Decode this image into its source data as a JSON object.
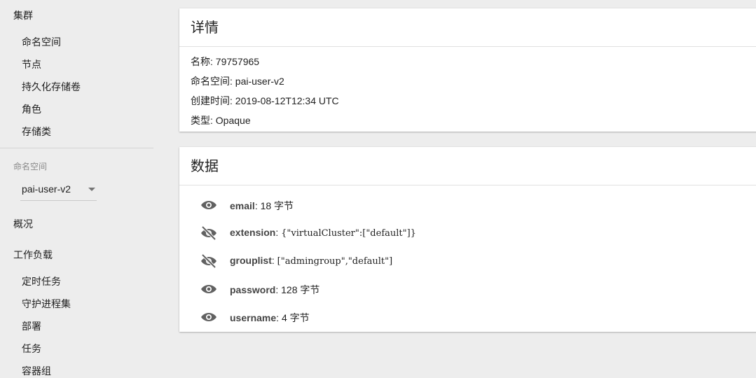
{
  "sidebar": {
    "cluster_label": "集群",
    "cluster_items": [
      "命名空间",
      "节点",
      "持久化存储卷",
      "角色",
      "存储类"
    ],
    "namespace_label": "命名空间",
    "namespace_value": "pai-user-v2",
    "overview_label": "概况",
    "workloads_label": "工作负载",
    "workload_items": [
      "定时任务",
      "守护进程集",
      "部署",
      "任务",
      "容器组"
    ]
  },
  "details": {
    "title": "详情",
    "name_label": "名称",
    "name_value": "79757965",
    "namespace_label": "命名空间",
    "namespace_value": "pai-user-v2",
    "created_label": "创建时间",
    "created_value": "2019-08-12T12:34 UTC",
    "type_label": "类型",
    "type_value": "Opaque"
  },
  "data_section": {
    "title": "数据",
    "rows": [
      {
        "key": "email",
        "value": "18 字节",
        "icon": "visibility-icon",
        "revealed": false
      },
      {
        "key": "extension",
        "value": "{\"virtualCluster\":[\"default\"]}",
        "icon": "visibility-off-icon",
        "revealed": true
      },
      {
        "key": "grouplist",
        "value": "[\"admingroup\",\"default\"]",
        "icon": "visibility-off-icon",
        "revealed": true
      },
      {
        "key": "password",
        "value": "128 字节",
        "icon": "visibility-icon",
        "revealed": false
      },
      {
        "key": "username",
        "value": "4 字节",
        "icon": "visibility-icon",
        "revealed": false
      }
    ]
  },
  "colors": {
    "background": "#ededed",
    "card": "#ffffff",
    "icon": "#616161"
  }
}
